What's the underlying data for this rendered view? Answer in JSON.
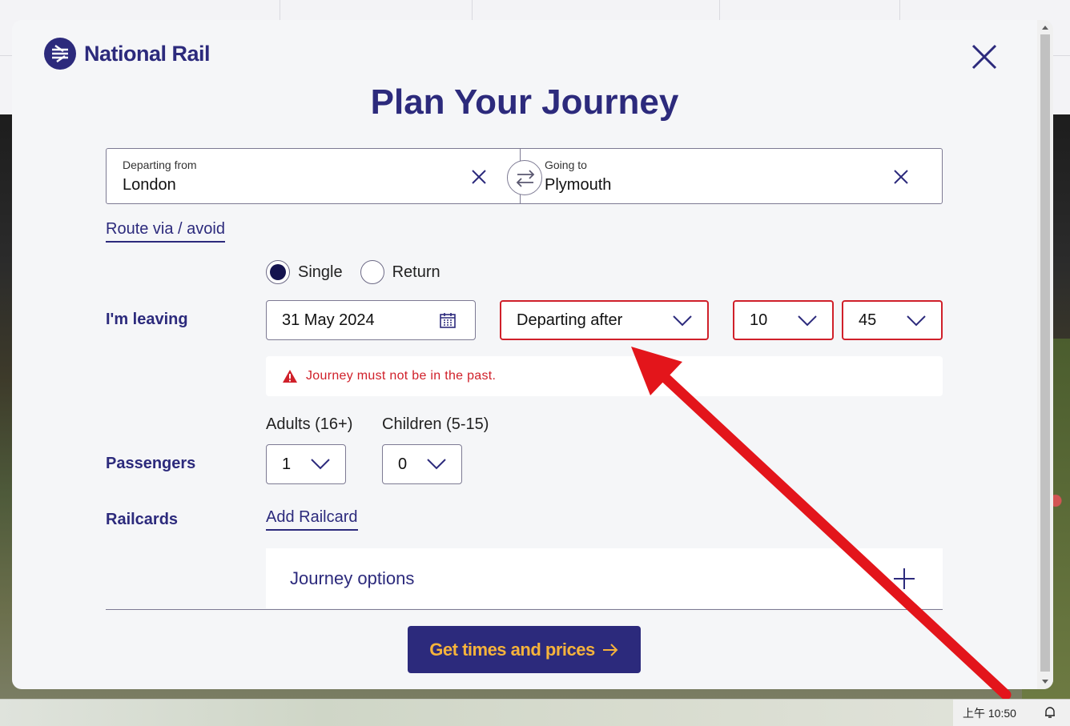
{
  "brand": {
    "name": "National Rail",
    "color": "#2c2a7c",
    "accent": "#f6b33b"
  },
  "title": "Plan Your Journey",
  "stations": {
    "from_label": "Departing from",
    "from_value": "London",
    "to_label": "Going to",
    "to_value": "Plymouth"
  },
  "route_link": "Route via / avoid",
  "journey_type": {
    "single": "Single",
    "return": "Return",
    "selected": "Single"
  },
  "leaving": {
    "label": "I'm leaving",
    "date": "31 May 2024",
    "mode": "Departing after",
    "hour": "10",
    "minute": "45"
  },
  "error": {
    "message": "Journey must not be in the past.",
    "color": "#d0202a"
  },
  "passengers": {
    "label": "Passengers",
    "adults_label": "Adults (16+)",
    "adults_value": "1",
    "children_label": "Children (5-15)",
    "children_value": "0"
  },
  "railcards": {
    "label": "Railcards",
    "add_link": "Add Railcard"
  },
  "options": {
    "label": "Journey options"
  },
  "cta": {
    "label": "Get times and prices"
  },
  "taskbar": {
    "clock": "上午 10:50"
  },
  "icons": [
    "national-rail-logo-icon",
    "close-icon",
    "clear-icon",
    "swap-icon",
    "calendar-icon",
    "chevron-down-icon",
    "warning-icon",
    "plus-icon",
    "arrow-right-icon",
    "notification-icon"
  ]
}
